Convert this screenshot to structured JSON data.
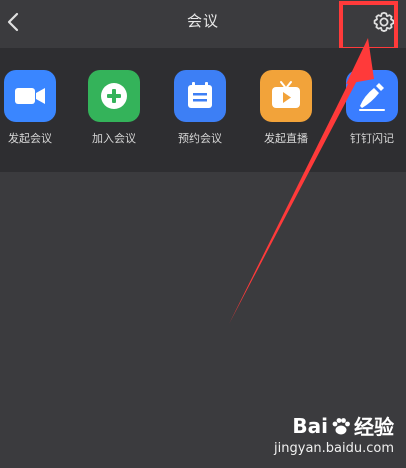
{
  "header": {
    "title": "会议"
  },
  "apps": [
    {
      "label": "发起会议",
      "color": "#3a86ff",
      "icon": "video-camera-icon"
    },
    {
      "label": "加入会议",
      "color": "#34b35a",
      "icon": "plus-circle-icon"
    },
    {
      "label": "预约会议",
      "color": "#3d7ff5",
      "icon": "calendar-icon"
    },
    {
      "label": "发起直播",
      "color": "#f2a33a",
      "icon": "live-tv-icon"
    },
    {
      "label": "钉钉闪记",
      "color": "#3a7dff",
      "icon": "pen-note-icon"
    }
  ],
  "annotation": {
    "color": "#ff3a3a"
  },
  "watermark": {
    "text_before": "Bai",
    "text_after": "经验",
    "url": "jingyan.baidu.com"
  }
}
